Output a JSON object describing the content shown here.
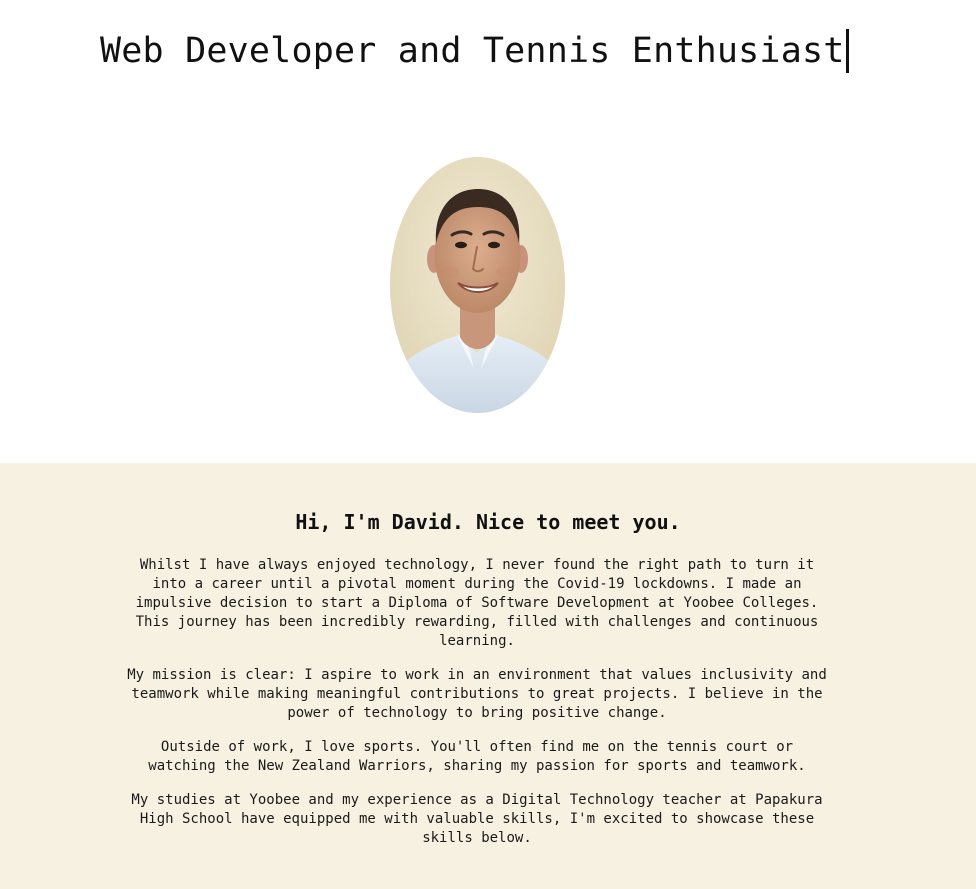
{
  "hero": {
    "title": "Web Developer and Tennis Enthusiast",
    "portrait_icon": "person-portrait-icon"
  },
  "about": {
    "heading": "Hi, I'm David. Nice to meet you.",
    "paragraphs": [
      "Whilst I have always enjoyed technology, I never found the right path to turn it into a career until a pivotal moment during the Covid-19 lockdowns. I made an impulsive decision to start a Diploma of Software Development at Yoobee Colleges. This journey has been incredibly rewarding, filled with challenges and continuous learning.",
      "My mission is clear: I aspire to work in an environment that values inclusivity and teamwork while making meaningful contributions to great projects. I believe in the power of technology to bring positive change.",
      "Outside of work, I love sports. You'll often find me on the tennis court or watching the New Zealand Warriors, sharing my passion for sports and teamwork.",
      "My studies at Yoobee and my experience as a Digital Technology teacher at Papakura High School have equipped me with valuable skills, I'm excited to showcase these skills below."
    ]
  },
  "colors": {
    "page_background": "#ffffff",
    "about_background": "#f7f1e2",
    "text": "#111111"
  }
}
